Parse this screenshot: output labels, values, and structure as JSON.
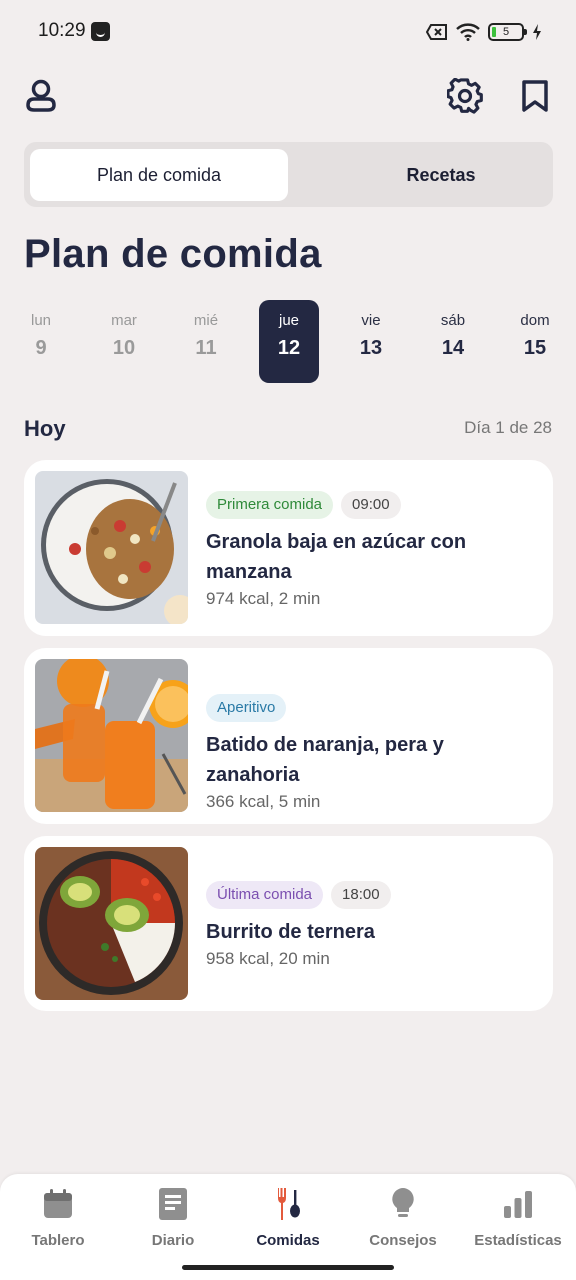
{
  "status_bar": {
    "time": "10:29",
    "battery": "5"
  },
  "tabs": [
    {
      "label": "Plan de comida",
      "active": true
    },
    {
      "label": "Recetas",
      "active": false
    }
  ],
  "page_title": "Plan de comida",
  "week": [
    {
      "name": "lun",
      "date": "9"
    },
    {
      "name": "mar",
      "date": "10"
    },
    {
      "name": "mié",
      "date": "11"
    },
    {
      "name": "jue",
      "date": "12",
      "selected": true
    },
    {
      "name": "vie",
      "date": "13"
    },
    {
      "name": "sáb",
      "date": "14"
    },
    {
      "name": "dom",
      "date": "15"
    }
  ],
  "section": {
    "title": "Hoy",
    "meta": "Día 1 de 28"
  },
  "meals": [
    {
      "tag": "Primera comida",
      "time": "09:00",
      "title": "Granola baja en azúcar con manzana",
      "info": "974 kcal, 2 min",
      "image": "granola-bowl"
    },
    {
      "tag": "Aperitivo",
      "time": "",
      "title": "Batido de naranja, pera y zanahoria",
      "info": "366 kcal, 5 min",
      "image": "orange-smoothie"
    },
    {
      "tag": "Última comida",
      "time": "18:00",
      "title": "Burrito de ternera",
      "info": "958 kcal, 20 min",
      "image": "beef-bowl"
    }
  ],
  "nav": [
    {
      "label": "Tablero",
      "icon": "calendar-icon"
    },
    {
      "label": "Diario",
      "icon": "notebook-icon"
    },
    {
      "label": "Comidas",
      "icon": "fork-spoon-icon",
      "active": true
    },
    {
      "label": "Consejos",
      "icon": "lightbulb-icon"
    },
    {
      "label": "Estadísticas",
      "icon": "bar-chart-icon"
    }
  ],
  "colors": {
    "primary": "#232842",
    "accent": "#e35a3c",
    "background": "#f2eeee"
  }
}
